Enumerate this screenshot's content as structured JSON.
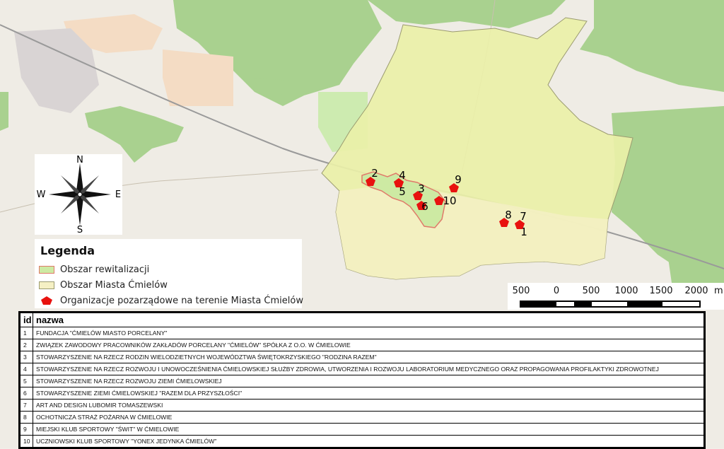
{
  "compass": {
    "north": "N",
    "east": "E",
    "south": "S",
    "west": "W"
  },
  "legend": {
    "title": "Legenda",
    "items": [
      {
        "label": "Obszar rewitalizacji",
        "fill": "#cdeaa3",
        "stroke": "#e07a6a"
      },
      {
        "label": "Obszar Miasta Ćmielów",
        "fill": "#f5f0c4",
        "stroke": "#9b9b70"
      },
      {
        "label": "Organizacje pozarządowe na terenie Miasta Ćmielów",
        "fill": "#e8120f",
        "icon": "red-pentagon-icon"
      }
    ]
  },
  "scale": {
    "labels": [
      "500",
      "0",
      "500",
      "1000",
      "1500",
      "2000"
    ],
    "unit": "m"
  },
  "markers": [
    {
      "id": "1",
      "label": "1"
    },
    {
      "id": "2",
      "label": "2"
    },
    {
      "id": "3",
      "label": "3"
    },
    {
      "id": "4",
      "label": "4"
    },
    {
      "id": "5",
      "label": "5"
    },
    {
      "id": "6",
      "label": "6"
    },
    {
      "id": "7",
      "label": "7"
    },
    {
      "id": "8",
      "label": "8"
    },
    {
      "id": "9",
      "label": "9"
    },
    {
      "id": "10",
      "label": "10"
    }
  ],
  "table": {
    "headers": [
      "id",
      "nazwa"
    ],
    "rows": [
      [
        "1",
        "FUNDACJA \"ĆMIELÓW MIASTO PORCELANY\""
      ],
      [
        "2",
        "ZWIĄZEK ZAWODOWY PRACOWNIKÓW ZAKŁADÓW PORCELANY \"ĆMIELÓW\" SPÓŁKA Z O.O. W ĆMIELOWIE"
      ],
      [
        "3",
        "STOWARZYSZENIE NA RZECZ RODZIN WIELODZIETNYCH WOJEWÓDZTWA ŚWIĘTOKRZYSKIEGO \"RODZINA RAZEM\""
      ],
      [
        "4",
        "STOWARZYSZENIE NA RZECZ ROZWOJU I UNOWOCZEŚNIENIA ĆMIELOWSKIEJ SŁUŻBY ZDROWIA, UTWORZENIA I ROZWOJU LABORATORIUM MEDYCZNEGO ORAZ PROPAGOWANIA PROFILAKTYKI ZDROWOTNEJ"
      ],
      [
        "5",
        "STOWARZYSZENIE NA RZECZ ROZWOJU ZIEMI ĆMIELOWSKIEJ"
      ],
      [
        "6",
        "STOWARZYSZENIE ZIEMI ĆMIELOWSKIEJ \"RAZEM DLA PRZYSZŁOŚCI\""
      ],
      [
        "7",
        "ART AND DESIGN LUBOMIR TOMASZEWSKI"
      ],
      [
        "8",
        "OCHOTNICZA STRAŻ POŻARNA W ĆMIELOWIE"
      ],
      [
        "9",
        "MIEJSKI KLUB SPORTOWY \"ŚWIT\" W ĆMIELOWIE"
      ],
      [
        "10",
        "UCZNIOWSKI KLUB SPORTOWY \"YONEX JEDYNKA ĆMIELÓW\""
      ]
    ]
  }
}
